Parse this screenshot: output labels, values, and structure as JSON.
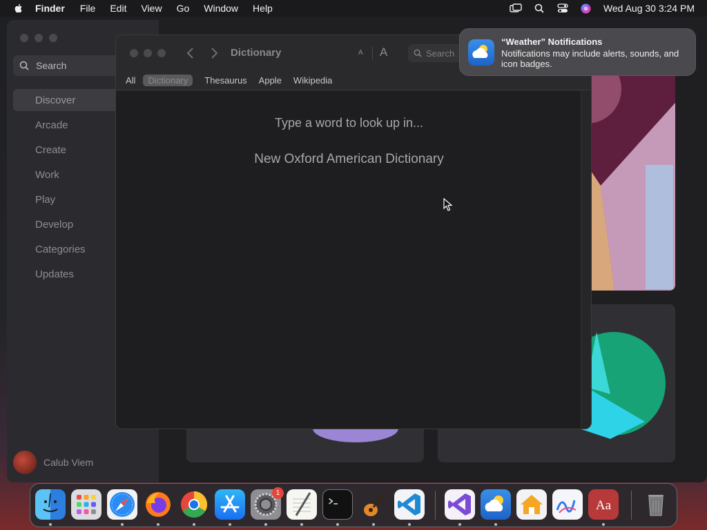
{
  "menubar": {
    "app_name": "Finder",
    "menus": [
      "File",
      "Edit",
      "View",
      "Go",
      "Window",
      "Help"
    ],
    "clock": "Wed Aug 30  3:24 PM"
  },
  "appstore": {
    "search_placeholder": "Search",
    "nav": [
      "Discover",
      "Arcade",
      "Create",
      "Work",
      "Play",
      "Develop",
      "Categories",
      "Updates"
    ],
    "selected_nav": "Discover",
    "user_name": "Calub Viem"
  },
  "dictionary": {
    "title": "Dictionary",
    "font_small": "A",
    "font_large": "A",
    "search_placeholder": "Search",
    "tabs": [
      "All",
      "Dictionary",
      "Thesaurus",
      "Apple",
      "Wikipedia"
    ],
    "selected_tab": "Dictionary",
    "prompt": "Type a word to look up in...",
    "source": "New Oxford American Dictionary"
  },
  "notification": {
    "title": "“Weather” Notifications",
    "body": "Notifications may include alerts, sounds, and icon badges."
  },
  "dock": {
    "apps": [
      "Finder",
      "Launchpad",
      "Safari",
      "Firefox",
      "Chrome",
      "App Store",
      "System Settings",
      "TextEdit",
      "Terminal",
      "GarageBand",
      "Visual Studio Code",
      "Visual Studio",
      "Weather",
      "Home",
      "Freeform",
      "Dictionary",
      "Trash"
    ],
    "settings_badge": "1"
  }
}
